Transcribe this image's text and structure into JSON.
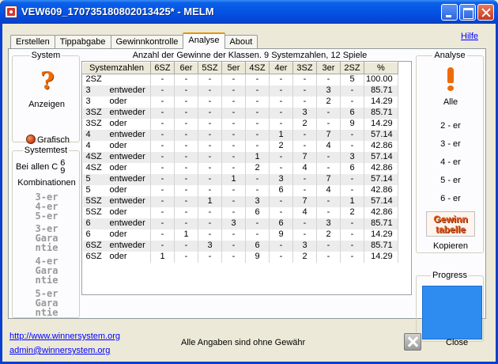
{
  "window": {
    "title": "VEW609_170735180802013425* - MELM"
  },
  "tabs": [
    "Erstellen",
    "Tippabgabe",
    "Gewinnkontrolle",
    "Analyse",
    "About"
  ],
  "hilfe": "Hilfe",
  "system": {
    "legend": "System",
    "anzeigen": "Anzeigen",
    "grafisch": "Grafisch"
  },
  "systemtest": {
    "legend": "Systemtest",
    "bei_allen": "Bei allen C",
    "c_top": "6",
    "c_bottom": "9",
    "kombinationen": "Kombinationen",
    "g3": "3-er\n4-er\n5-er",
    "g4": "3-er\nGara\nntie",
    "g5": "4-er\nGara\nntie",
    "g6": "5-er\nGara\nntie"
  },
  "table": {
    "legend": "Anzahl der Gewinne der Klassen. 9 Systemzahlen, 12 Spiele",
    "columns": [
      "Systemzahlen",
      "6SZ",
      "6er",
      "5SZ",
      "5er",
      "4SZ",
      "4er",
      "3SZ",
      "3er",
      "2SZ",
      "%"
    ],
    "rows": [
      [
        "2SZ",
        "",
        "-",
        "-",
        "-",
        "-",
        "-",
        "-",
        "-",
        "-",
        "5",
        "100.00"
      ],
      [
        "3",
        "entweder",
        "-",
        "-",
        "-",
        "-",
        "-",
        "-",
        "-",
        "3",
        "-",
        "85.71"
      ],
      [
        "3",
        "oder",
        "-",
        "-",
        "-",
        "-",
        "-",
        "-",
        "-",
        "2",
        "-",
        "14.29"
      ],
      [
        "3SZ",
        "entweder",
        "-",
        "-",
        "-",
        "-",
        "-",
        "-",
        "3",
        "-",
        "6",
        "85.71"
      ],
      [
        "3SZ",
        "oder",
        "-",
        "-",
        "-",
        "-",
        "-",
        "-",
        "2",
        "-",
        "9",
        "14.29"
      ],
      [
        "4",
        "entweder",
        "-",
        "-",
        "-",
        "-",
        "-",
        "1",
        "-",
        "7",
        "-",
        "57.14"
      ],
      [
        "4",
        "oder",
        "-",
        "-",
        "-",
        "-",
        "-",
        "2",
        "-",
        "4",
        "-",
        "42.86"
      ],
      [
        "4SZ",
        "entweder",
        "-",
        "-",
        "-",
        "-",
        "1",
        "-",
        "7",
        "-",
        "3",
        "57.14"
      ],
      [
        "4SZ",
        "oder",
        "-",
        "-",
        "-",
        "-",
        "2",
        "-",
        "4",
        "-",
        "6",
        "42.86"
      ],
      [
        "5",
        "entweder",
        "-",
        "-",
        "-",
        "1",
        "-",
        "3",
        "-",
        "7",
        "-",
        "57.14"
      ],
      [
        "5",
        "oder",
        "-",
        "-",
        "-",
        "-",
        "-",
        "6",
        "-",
        "4",
        "-",
        "42.86"
      ],
      [
        "5SZ",
        "entweder",
        "-",
        "-",
        "1",
        "-",
        "3",
        "-",
        "7",
        "-",
        "1",
        "57.14"
      ],
      [
        "5SZ",
        "oder",
        "-",
        "-",
        "-",
        "-",
        "6",
        "-",
        "4",
        "-",
        "2",
        "42.86"
      ],
      [
        "6",
        "entweder",
        "-",
        "-",
        "-",
        "3",
        "-",
        "6",
        "-",
        "3",
        "-",
        "85.71"
      ],
      [
        "6",
        "oder",
        "-",
        "1",
        "-",
        "-",
        "-",
        "9",
        "-",
        "2",
        "-",
        "14.29"
      ],
      [
        "6SZ",
        "entweder",
        "-",
        "-",
        "3",
        "-",
        "6",
        "-",
        "3",
        "-",
        "-",
        "85.71"
      ],
      [
        "6SZ",
        "oder",
        "1",
        "-",
        "-",
        "-",
        "9",
        "-",
        "2",
        "-",
        "-",
        "14.29"
      ]
    ]
  },
  "analyse": {
    "legend": "Analyse",
    "alle": "Alle",
    "items": [
      "2 - er",
      "3 - er",
      "4 - er",
      "5 - er",
      "6 - er"
    ],
    "gewinn_line1": "Gewinn",
    "gewinn_line2": "tabelle",
    "kopieren": "Kopieren",
    "progress_legend": "Progress"
  },
  "footer": {
    "link1": "http://www.winnersystem.org",
    "link2": "admin@winnersystem.org",
    "disclaimer": "Alle Angaben sind ohne Gewähr",
    "close": "Close"
  },
  "colors": {
    "accent": "#ee6b0a",
    "progress": "#2e8cf0"
  }
}
